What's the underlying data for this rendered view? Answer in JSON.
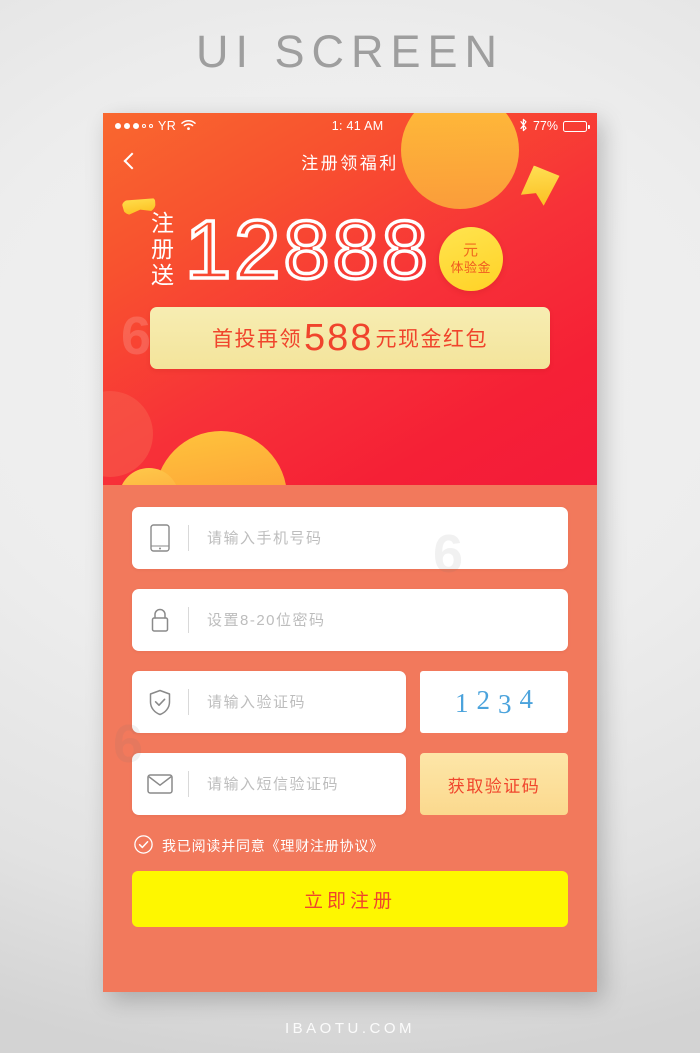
{
  "page": {
    "title": "UI SCREEN",
    "footer": "IBAOTU.COM"
  },
  "status_bar": {
    "carrier": "YR",
    "signal_dots_filled": 3,
    "signal_dots_total": 5,
    "wifi_icon": "wifi-icon",
    "time": "1: 41 AM",
    "bluetooth_icon": "bluetooth-icon",
    "battery_percent": "77%",
    "battery_level": 72
  },
  "navbar": {
    "back_icon": "chevron-left-icon",
    "title": "注册领福利"
  },
  "hero": {
    "give_label_line1": "注",
    "give_label_line2": "册",
    "give_label_line3": "送",
    "amount": "12888",
    "badge_unit": "元",
    "badge_label": "体验金",
    "promo_prefix": "首投再领",
    "promo_amount": "588",
    "promo_suffix": "元现金红包",
    "colors": {
      "hero_gradient_start": "#F9682F",
      "hero_gradient_end": "#F41B3A",
      "body_bg": "#F2795C",
      "badge_yellow": "#FFD226",
      "promo_bg": "#F3E49B",
      "promo_text": "#F0442C"
    }
  },
  "form": {
    "phone": {
      "icon": "phone-icon",
      "placeholder": "请输入手机号码",
      "value": ""
    },
    "password": {
      "icon": "lock-icon",
      "placeholder": "设置8-20位密码",
      "value": ""
    },
    "captcha": {
      "icon": "shield-check-icon",
      "placeholder": "请输入验证码",
      "value": "",
      "image_digits": [
        "1",
        "2",
        "3",
        "4"
      ],
      "image_color": "#4BA3DC"
    },
    "sms": {
      "icon": "envelope-icon",
      "placeholder": "请输入短信验证码",
      "value": "",
      "send_button_label": "获取验证码"
    },
    "agreement": {
      "check_icon": "check-circle-icon",
      "text": "我已阅读并同意《理财注册协议》",
      "checked": true
    },
    "submit_label": "立即注册",
    "submit_color": "#FEF700"
  },
  "watermarks": {
    "mark": "6"
  }
}
